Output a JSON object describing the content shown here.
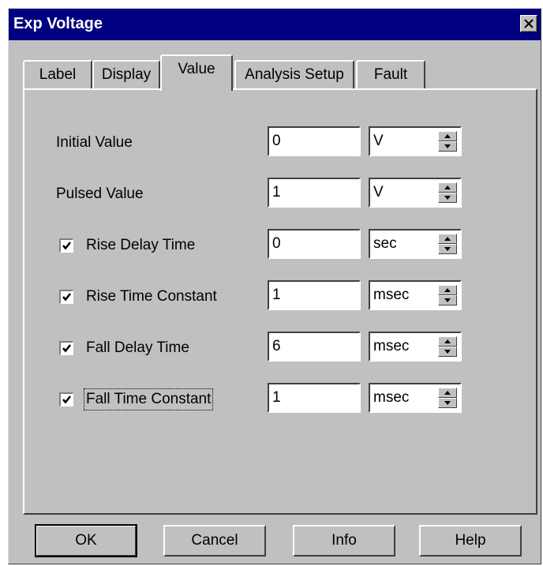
{
  "window": {
    "title": "Exp Voltage"
  },
  "tabs": [
    {
      "label": "Label"
    },
    {
      "label": "Display"
    },
    {
      "label": "Value"
    },
    {
      "label": "Analysis Setup"
    },
    {
      "label": "Fault"
    }
  ],
  "active_tab": "Value",
  "rows": [
    {
      "label": "Initial Value",
      "has_checkbox": false,
      "value": "0",
      "unit": "V"
    },
    {
      "label": "Pulsed Value",
      "has_checkbox": false,
      "value": "1",
      "unit": "V"
    },
    {
      "label": "Rise Delay Time",
      "has_checkbox": true,
      "checked": true,
      "value": "0",
      "unit": "sec"
    },
    {
      "label": "Rise Time Constant",
      "has_checkbox": true,
      "checked": true,
      "value": "1",
      "unit": "msec"
    },
    {
      "label": "Fall Delay Time",
      "has_checkbox": true,
      "checked": true,
      "value": "6",
      "unit": "msec"
    },
    {
      "label": "Fall Time Constant",
      "has_checkbox": true,
      "checked": true,
      "value": "1",
      "unit": "msec"
    }
  ],
  "buttons": {
    "ok": "OK",
    "cancel": "Cancel",
    "info": "Info",
    "help": "Help"
  },
  "icons": {
    "close": "close-icon",
    "spin_up": "spin-up-icon",
    "spin_down": "spin-down-icon",
    "check": "checkmark-icon"
  },
  "colors": {
    "titlebar": "#000080",
    "face": "#c0c0c0"
  }
}
